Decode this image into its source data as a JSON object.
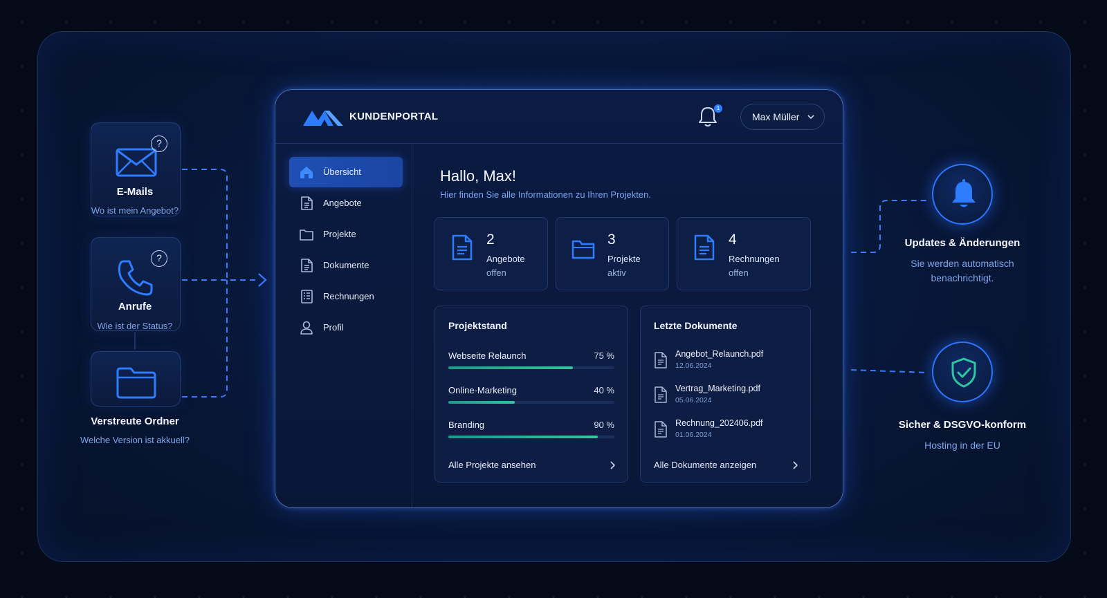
{
  "problems": [
    {
      "title": "E-Mails",
      "question": "Wo ist mein Angebot?",
      "icon": "envelope-icon",
      "badge": "?"
    },
    {
      "title": "Anrufe",
      "question": "Wie ist der Status?",
      "icon": "phone-icon",
      "badge": "?"
    },
    {
      "title": "Verstreute Ordner",
      "question": "Welche Version ist akkuell?",
      "icon": "folder-icon"
    }
  ],
  "portal": {
    "brand": "KUNDENPORTAL",
    "notification_count": "1",
    "user_name": "Max Müller",
    "nav": [
      {
        "label": "Übersicht",
        "icon": "home-icon",
        "active": true
      },
      {
        "label": "Angebote",
        "icon": "document-icon"
      },
      {
        "label": "Projekte",
        "icon": "folder-icon"
      },
      {
        "label": "Dokumente",
        "icon": "document-icon"
      },
      {
        "label": "Rechnungen",
        "icon": "invoice-icon"
      },
      {
        "label": "Profil",
        "icon": "user-icon"
      }
    ],
    "greeting": "Hallo, Max!",
    "greeting_sub": "Hier finden Sie alle Informationen zu Ihren Projekten.",
    "stats": [
      {
        "value": "2",
        "label1": "Angebote",
        "label2": "offen",
        "icon": "document-icon"
      },
      {
        "value": "3",
        "label1": "Projekte",
        "label2": "aktiv",
        "icon": "folder-icon"
      },
      {
        "value": "4",
        "label1": "Rechnungen",
        "label2": "offen",
        "icon": "invoice-icon"
      }
    ],
    "project_panel": {
      "title": "Projektstand",
      "projects": [
        {
          "name": "Webseite Relaunch",
          "percent_label": "75 %",
          "progress": 0.75
        },
        {
          "name": "Online-Marketing",
          "percent_label": "40 %",
          "progress": 0.4
        },
        {
          "name": "Branding",
          "percent_label": "90 %",
          "progress": 0.9
        }
      ],
      "link": "Alle Projekte ansehen"
    },
    "docs_panel": {
      "title": "Letzte Dokumente",
      "documents": [
        {
          "name": "Angebot_Relaunch.pdf",
          "date": "12.06.2024"
        },
        {
          "name": "Vertrag_Marketing.pdf",
          "date": "05.06.2024"
        },
        {
          "name": "Rechnung_202406.pdf",
          "date": "01.06.2024"
        }
      ],
      "link": "Alle Dokumente anzeigen"
    }
  },
  "features": [
    {
      "title": "Updates & Änderungen",
      "subtitle_line1": "Sie werden automatisch",
      "subtitle_line2": "benachrichtigt.",
      "icon": "bell-icon"
    },
    {
      "title": "Sicher & DSGVO-konform",
      "subtitle_line1": "Hosting in der EU",
      "subtitle_line2": "",
      "icon": "shield-check-icon"
    }
  ],
  "colors": {
    "accent": "#2f80ff",
    "progress": "#2bb396",
    "subtext": "#7fa6ea",
    "background": "#050b18"
  }
}
